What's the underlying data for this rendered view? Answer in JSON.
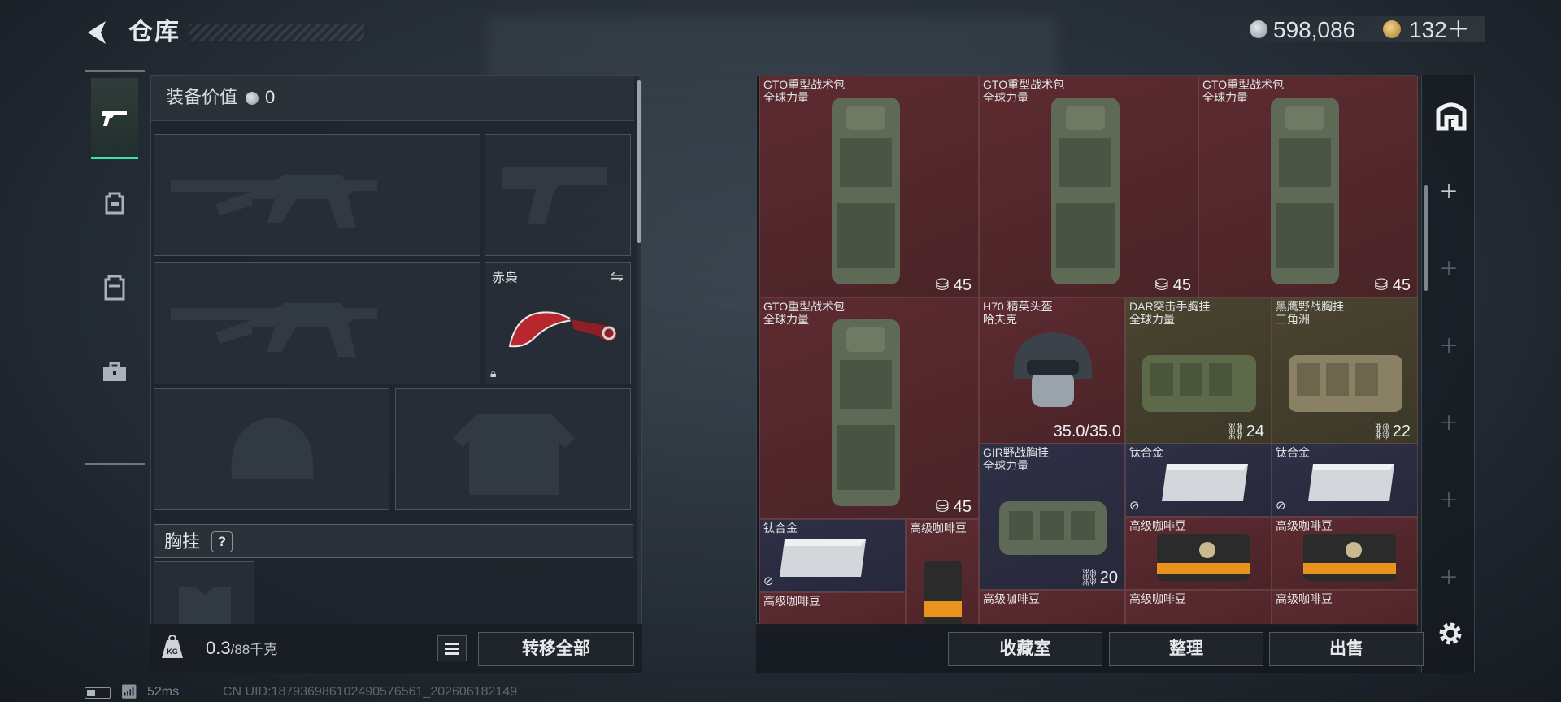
{
  "header": {
    "title": "仓库",
    "money": "598,086",
    "coupon": "132＋"
  },
  "equipment": {
    "value_label": "装备价值",
    "value": "0",
    "melee_name": "赤枭",
    "rig_label": "胸挂",
    "rig_help": "?"
  },
  "footer": {
    "weight_current": "0.3",
    "weight_max": "/88千克",
    "transfer_all": "转移全部"
  },
  "status": {
    "ping": "52ms",
    "uid": "CN UID:187936986102490576561_202606182149"
  },
  "stash": {
    "items": [
      {
        "name": "GTO重型战术包",
        "sub": "全球力量",
        "count": "45",
        "bg": "red"
      },
      {
        "name": "GTO重型战术包",
        "sub": "全球力量",
        "count": "45",
        "bg": "red"
      },
      {
        "name": "GTO重型战术包",
        "sub": "全球力量",
        "count": "45",
        "bg": "red"
      },
      {
        "name": "GTO重型战术包",
        "sub": "全球力量",
        "count": "45",
        "bg": "red"
      },
      {
        "name": "H70 精英头盔",
        "sub": "哈夫克",
        "durability": "35.0/35.0",
        "bg": "red"
      },
      {
        "name": "DAR突击手胸挂",
        "sub": "全球力量",
        "count": "24",
        "bg": "gold"
      },
      {
        "name": "黑鹰野战胸挂",
        "sub": "三角洲",
        "count": "22",
        "bg": "gold"
      },
      {
        "name": "GIR野战胸挂",
        "sub": "全球力量",
        "count": "20",
        "bg": "blue"
      },
      {
        "name": "钛合金",
        "bg": "blue"
      },
      {
        "name": "钛合金",
        "bg": "blue"
      },
      {
        "name": "钛合金",
        "bg": "blue"
      },
      {
        "name": "高级咖啡豆",
        "bg": "red"
      },
      {
        "name": "高级咖啡豆",
        "bg": "red"
      },
      {
        "name": "高级咖啡豆",
        "bg": "red"
      },
      {
        "name": "高级咖啡豆",
        "bg": "red"
      },
      {
        "name": "高级咖啡豆",
        "bg": "red"
      },
      {
        "name": "高级咖啡豆",
        "bg": "red"
      },
      {
        "name": "高级咖啡豆",
        "bg": "red"
      }
    ]
  },
  "buttons": {
    "favorites": "收藏室",
    "sort": "整理",
    "sell": "出售"
  },
  "colors": {
    "accent": "#3fe0b0",
    "cell_red": "#5c2b30",
    "cell_blue": "#2f3046",
    "cell_gold": "#4a4430"
  }
}
